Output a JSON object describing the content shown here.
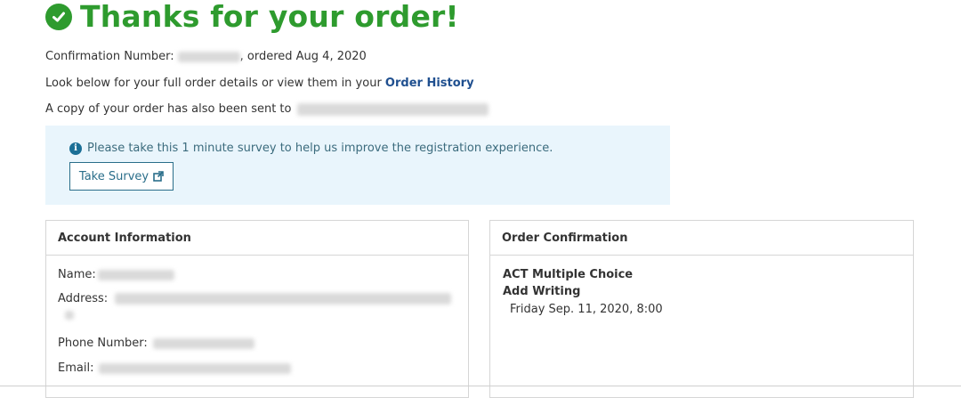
{
  "header": {
    "title": "Thanks for your order!",
    "icon": "check-circle-icon",
    "color": "#2e9b2e"
  },
  "confirmation": {
    "label": "Confirmation Number:",
    "ordered_text": ", ordered Aug 4, 2020"
  },
  "details_line": {
    "text": "Look below for your full order details or view them in your ",
    "link": "Order History"
  },
  "copy_line": {
    "text": "A copy of your order has also been sent to"
  },
  "survey": {
    "message": "Please take this 1 minute survey to help us improve the registration experience.",
    "button": "Take Survey"
  },
  "account": {
    "title": "Account Information",
    "name_label": "Name:",
    "address_label": "Address:",
    "phone_label": "Phone Number:",
    "email_label": "Email:"
  },
  "order_confirmation": {
    "title": "Order Confirmation",
    "item1": "ACT Multiple Choice",
    "item2": "Add Writing",
    "date": "Friday Sep. 11, 2020, 8:00"
  }
}
